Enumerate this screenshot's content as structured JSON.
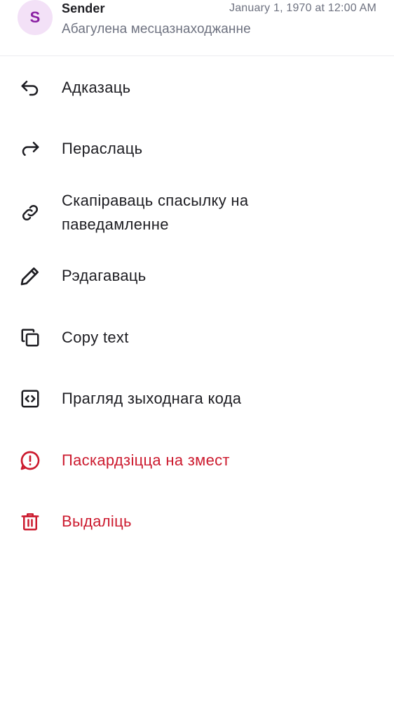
{
  "header": {
    "avatar_letter": "S",
    "sender": "Sender",
    "timestamp": "January 1, 1970 at 12:00 AM",
    "location": "Абагулена месцазнаходжанне"
  },
  "menu": {
    "reply": "Адказаць",
    "forward": "Пераслаць",
    "copy_link": "Скапіраваць спасылку на паведамленне",
    "edit": "Рэдагаваць",
    "copy_text": "Copy text",
    "view_source": "Прагляд зыходнага кода",
    "report": "Паскардзіцца на змест",
    "delete": "Выдаліць"
  },
  "colors": {
    "text": "#1d1d22",
    "secondary": "#6e7280",
    "danger": "#cc1a2e",
    "avatar_bg": "#f3e1f7",
    "avatar_fg": "#8a1fa3"
  }
}
